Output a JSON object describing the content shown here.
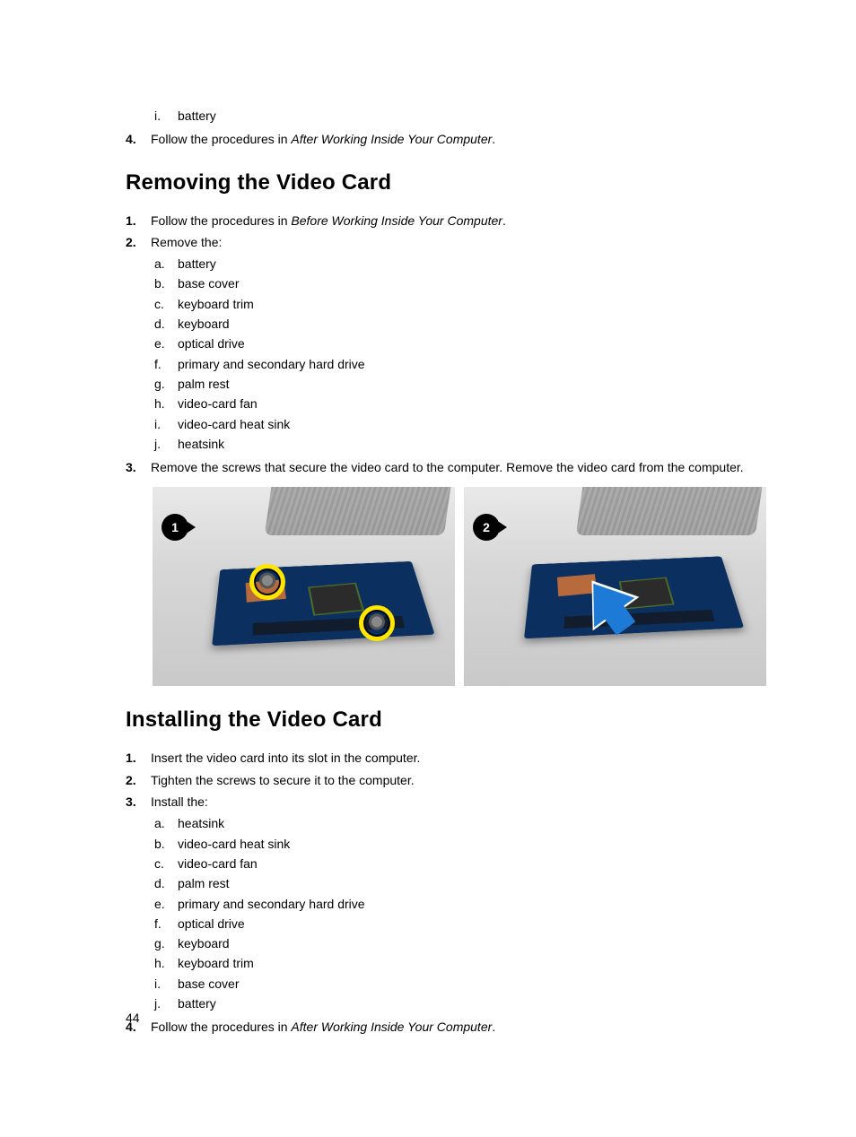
{
  "top_fragment": {
    "sub_items": [
      {
        "marker": "i.",
        "text": "battery"
      }
    ],
    "step4": {
      "marker": "4.",
      "prefix": "Follow the procedures in ",
      "italic": "After Working Inside Your Computer",
      "suffix": "."
    }
  },
  "section_remove": {
    "heading": "Removing the Video Card",
    "steps": [
      {
        "marker": "1.",
        "prefix": "Follow the procedures in ",
        "italic": "Before Working Inside Your Computer",
        "suffix": "."
      },
      {
        "marker": "2.",
        "text": "Remove the:",
        "sub": [
          {
            "marker": "a.",
            "text": "battery"
          },
          {
            "marker": "b.",
            "text": "base cover"
          },
          {
            "marker": "c.",
            "text": "keyboard trim"
          },
          {
            "marker": "d.",
            "text": "keyboard"
          },
          {
            "marker": "e.",
            "text": "optical drive"
          },
          {
            "marker": "f.",
            "text": "primary and secondary hard drive"
          },
          {
            "marker": "g.",
            "text": "palm rest"
          },
          {
            "marker": "h.",
            "text": "video-card fan"
          },
          {
            "marker": "i.",
            "text": "video-card heat sink"
          },
          {
            "marker": "j.",
            "text": "heatsink"
          }
        ]
      },
      {
        "marker": "3.",
        "text": "Remove the screws that secure the video card to the computer. Remove the video card from the computer."
      }
    ],
    "figure": {
      "badge1": "1",
      "badge2": "2"
    }
  },
  "section_install": {
    "heading": "Installing the Video Card",
    "steps": [
      {
        "marker": "1.",
        "text": "Insert the video card into its slot in the computer."
      },
      {
        "marker": "2.",
        "text": "Tighten the screws to secure it to the computer."
      },
      {
        "marker": "3.",
        "text": "Install the:",
        "sub": [
          {
            "marker": "a.",
            "text": "heatsink"
          },
          {
            "marker": "b.",
            "text": "video-card heat sink"
          },
          {
            "marker": "c.",
            "text": "video-card fan"
          },
          {
            "marker": "d.",
            "text": "palm rest"
          },
          {
            "marker": "e.",
            "text": "primary and secondary hard drive"
          },
          {
            "marker": "f.",
            "text": "optical drive"
          },
          {
            "marker": "g.",
            "text": "keyboard"
          },
          {
            "marker": "h.",
            "text": "keyboard trim"
          },
          {
            "marker": "i.",
            "text": "base cover"
          },
          {
            "marker": "j.",
            "text": "battery"
          }
        ]
      },
      {
        "marker": "4.",
        "prefix": "Follow the procedures in ",
        "italic": "After Working Inside Your Computer",
        "suffix": "."
      }
    ]
  },
  "page_number": "44"
}
